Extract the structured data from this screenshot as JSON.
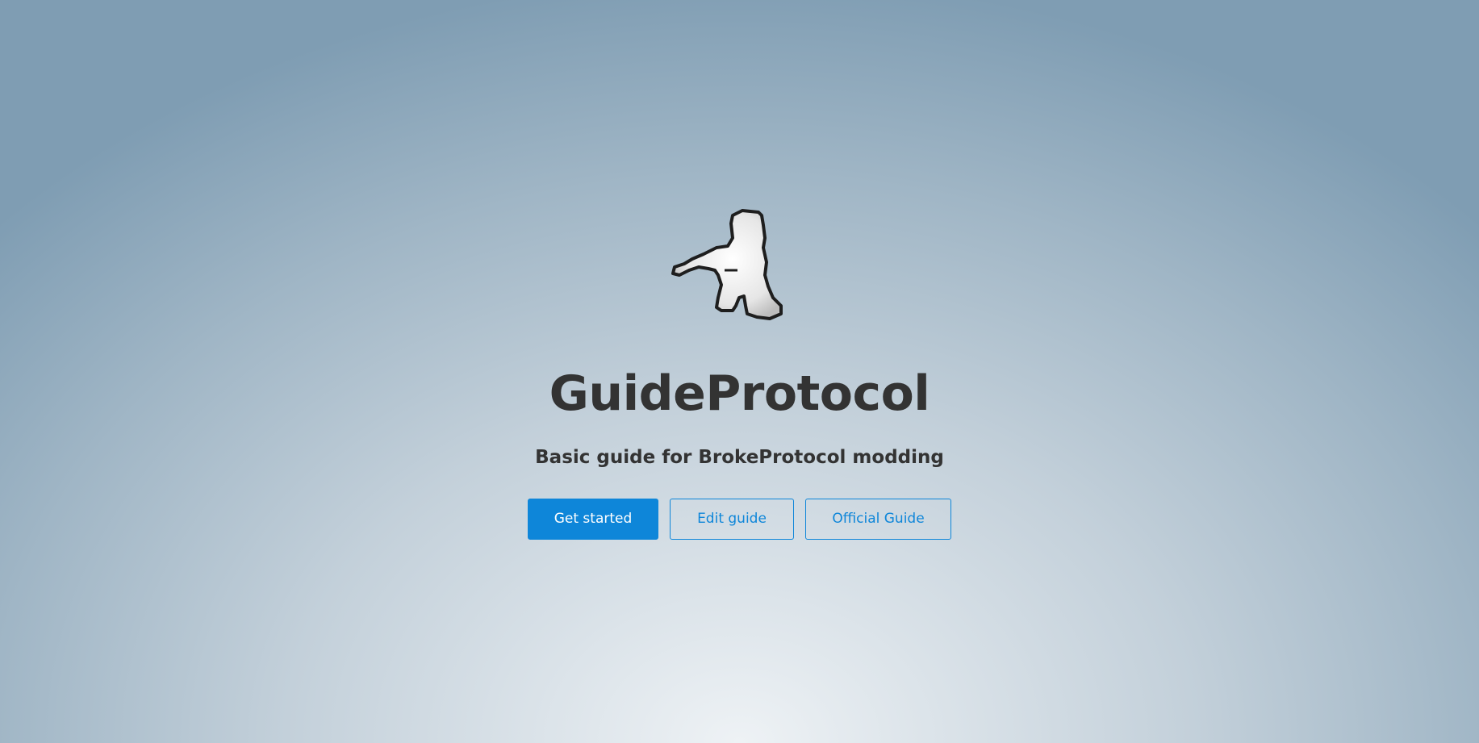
{
  "cover": {
    "title": "GuideProtocol",
    "subtitle": "Basic guide for BrokeProtocol modding",
    "logo_icon": "soldier-with-rifle-icon",
    "buttons": {
      "get_started": "Get started",
      "edit_guide": "Edit guide",
      "official_guide": "Official Guide"
    }
  },
  "colors": {
    "accent": "#0e86d9",
    "text": "#333333",
    "background_center": "#eef2f5",
    "background_edge": "#7f9db3"
  }
}
